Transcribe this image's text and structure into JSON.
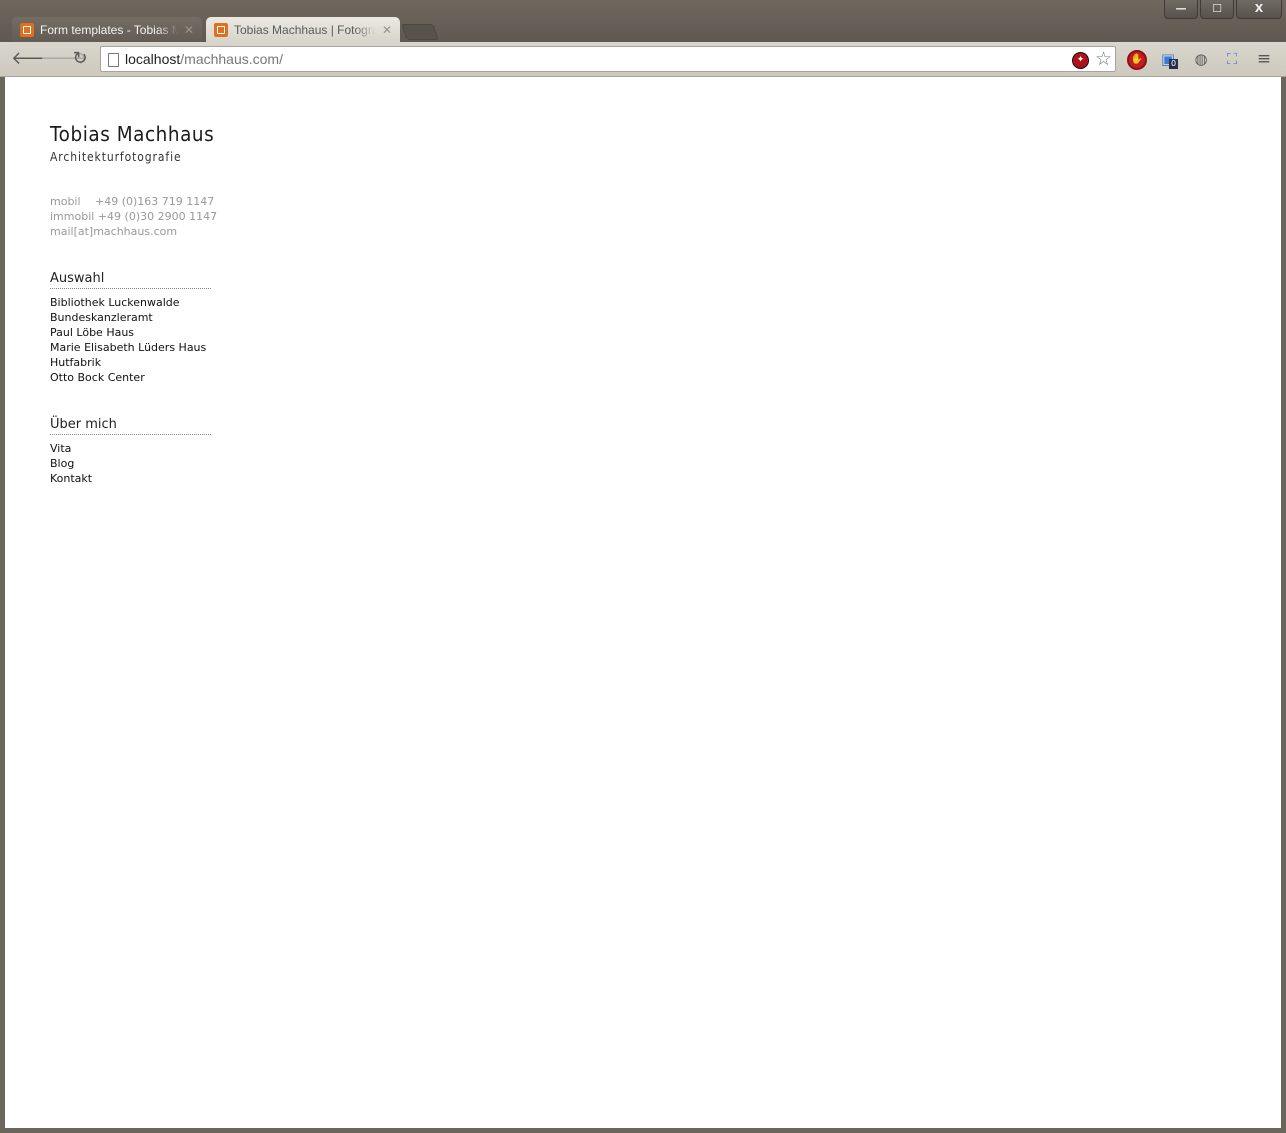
{
  "browser": {
    "tabs": [
      {
        "title": "Form templates - Tobias Mac",
        "active": false
      },
      {
        "title": "Tobias Machhaus | Fotografie",
        "active": true
      }
    ],
    "window_controls": {
      "minimize": "—",
      "maximize": "☐",
      "close": "X"
    },
    "address": {
      "host": "localhost",
      "path": "/machhaus.com/"
    },
    "extension_badge": "0"
  },
  "site": {
    "title": "Tobias Machhaus",
    "subtitle": "Architekturfotografie",
    "contact": {
      "mobil_label": "mobil",
      "mobil_value": "+49 (0)163 719 1147",
      "immobil_label": "immobil",
      "immobil_value": "+49 (0)30 2900 1147",
      "email": "mail[at]machhaus.com"
    },
    "sections": [
      {
        "heading": "Auswahl",
        "items": [
          "Bibliothek Luckenwalde",
          "Bundeskanzleramt",
          "Paul Löbe Haus",
          "Marie Elisabeth Lüders Haus",
          "Hutfabrik",
          "Otto Bock Center"
        ]
      },
      {
        "heading": "Über mich",
        "items": [
          "Vita",
          "Blog",
          "Kontakt"
        ]
      }
    ]
  }
}
